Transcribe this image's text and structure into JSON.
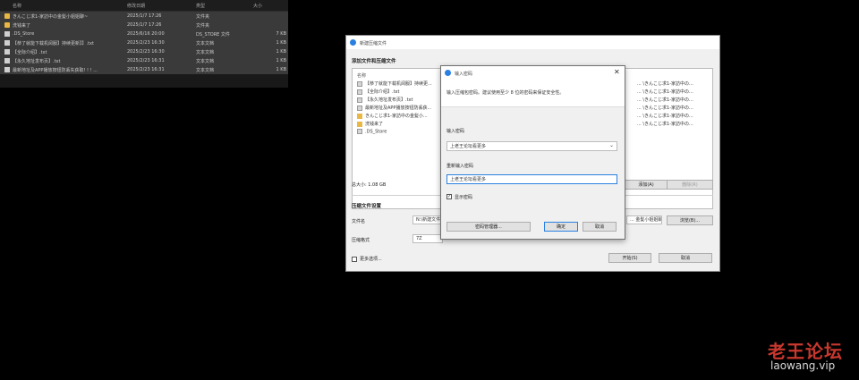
{
  "explorer": {
    "columns": [
      "名称",
      "修改日期",
      "类型",
      "大小"
    ],
    "rows": [
      {
        "icon": "folder-icon",
        "name": "きんこじ求1-家訪中の金髪小姐姐聊~",
        "date": "2025/1/7 17:26",
        "type": "文件夹",
        "size": ""
      },
      {
        "icon": "folder-icon",
        "name": "洗钱来了",
        "date": "2025/1/7 17:26",
        "type": "文件夹",
        "size": ""
      },
      {
        "icon": "file-icon",
        "name": ".DS_Store",
        "date": "2025/6/16 20:00",
        "type": "DS_STORE 文件",
        "size": "7 KB"
      },
      {
        "icon": "file-icon",
        "name": "【恭了就能下载机阅服】持续更新】】.txt",
        "date": "2025/2/23 16:30",
        "type": "文本文档",
        "size": "1 KB"
      },
      {
        "icon": "file-icon",
        "name": "【全际介绍】.txt",
        "date": "2025/2/23 16:30",
        "type": "文本文档",
        "size": "1 KB"
      },
      {
        "icon": "file-icon",
        "name": "【永久地址发布页】.txt",
        "date": "2025/2/23 16:31",
        "type": "文本文档",
        "size": "1 KB"
      },
      {
        "icon": "file-icon",
        "name": "最新地址及APP播放按钮防丢失获取! ! ! ...",
        "date": "2025/2/23 16:31",
        "type": "文本文档",
        "size": "1 KB"
      }
    ]
  },
  "main_dialog": {
    "title": "新建压缩文件",
    "section_files": "添加文件和压缩文件",
    "col_name": "名称",
    "files": [
      {
        "icon": "file-icon",
        "name": "【恭了就能下载机阅服】持续更..."
      },
      {
        "icon": "file-icon",
        "name": "【全际介绍】.txt"
      },
      {
        "icon": "file-icon",
        "name": "【永久地址发布页】.txt"
      },
      {
        "icon": "file-icon",
        "name": "最新地址及APP播放按钮防丢获..."
      },
      {
        "icon": "folder-icon",
        "name": "きんこじ求1-家訪中の金髪小..."
      },
      {
        "icon": "folder-icon",
        "name": "洗钱来了"
      },
      {
        "icon": "file-icon",
        "name": ".DS_Store"
      }
    ],
    "paths": [
      "... \\きんこじ求1-家訪中の...",
      "... \\きんこじ求1-家訪中の...",
      "... \\きんこじ求1-家訪中の...",
      "... \\きんこじ求1-家訪中の...",
      "... \\きんこじ求1-家訪中の...",
      "... \\きんこじ求1-家訪中の..."
    ],
    "total_size": "总大小: 1.08 GB",
    "add_button": "添加(A)",
    "remove_button": "删除(R)",
    "section_settings": "压缩文件设置",
    "filename_label": "文件名",
    "filename_value": "N:\\新建文件夹\\...",
    "filename_suffix": "... 金髪小姐姐聊 ...7z",
    "browse_button": "浏览(B)...",
    "level_label": "压缩格式",
    "level_value": "7Z",
    "more_options_label": "更多选项...",
    "start_button": "开始(S)",
    "cancel_button": "取消"
  },
  "password_dialog": {
    "title": "输入密码",
    "info": "输入压缩包密码。建议使用至少 8 位的密码来保证安全性。",
    "enter_label": "输入密码",
    "enter_value": "上老王论坛看更多",
    "confirm_label": "重新输入密码",
    "confirm_value": "上老王论坛看更多",
    "show_password_label": "显示密码",
    "show_password_checked": true,
    "manager_button": "密码管理器...",
    "ok_button": "确定",
    "cancel_button": "取消"
  },
  "watermark": {
    "cn": "老王论坛",
    "en": "laowang.vip"
  }
}
